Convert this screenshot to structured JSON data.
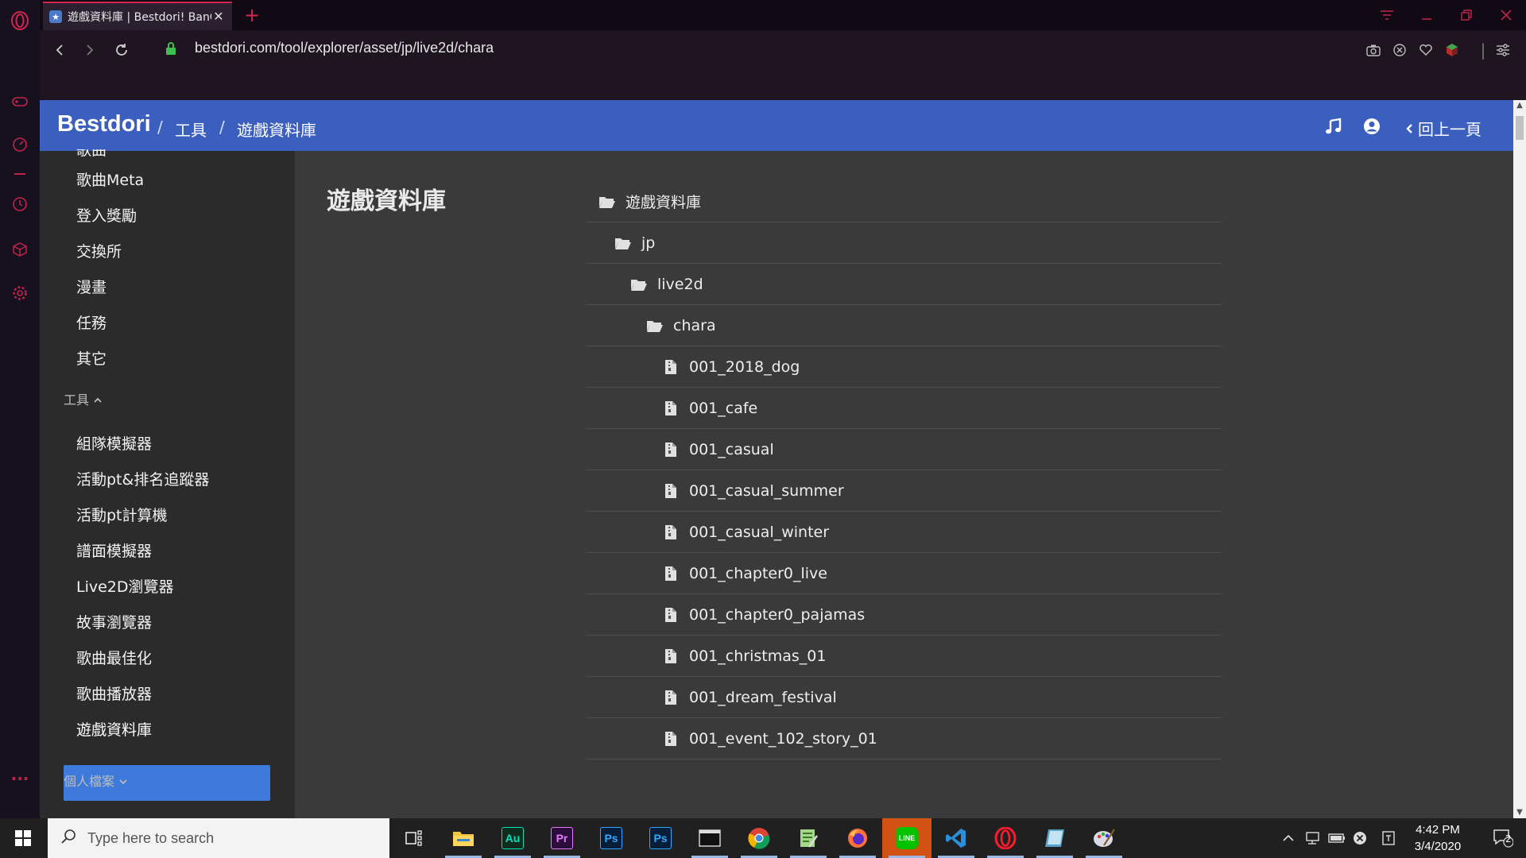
{
  "browser": {
    "tab_title": "遊戲資料庫 | Bestdori! BanG",
    "url": "bestdori.com/tool/explorer/asset/jp/live2d/chara",
    "accent": "#d1254f"
  },
  "navbar": {
    "brand": "Bestdori",
    "breadcrumb_sep": "/",
    "breadcrumb": [
      "工具",
      "遊戲資料庫"
    ],
    "back_label": "回上一頁",
    "color": "#3b5fbe"
  },
  "sidebar": {
    "partial_top_item": "歌曲",
    "items_a": [
      "歌曲Meta",
      "登入獎勵",
      "交換所",
      "漫畫",
      "任務",
      "其它"
    ],
    "tools_heading": "工具",
    "tools_items": [
      "組隊模擬器",
      "活動pt&排名追蹤器",
      "活動pt計算機",
      "譜面模擬器",
      "Live2D瀏覽器",
      "故事瀏覽器",
      "歌曲最佳化",
      "歌曲播放器",
      "遊戲資料庫"
    ],
    "active_item": "遊戲資料庫",
    "profile_heading": "個人檔案"
  },
  "main": {
    "title": "遊戲資料庫",
    "folders": [
      "遊戲資料庫",
      "jp",
      "live2d",
      "chara"
    ],
    "files": [
      "001_2018_dog",
      "001_cafe",
      "001_casual",
      "001_casual_summer",
      "001_casual_winter",
      "001_chapter0_live",
      "001_chapter0_pajamas",
      "001_christmas_01",
      "001_dream_festival",
      "001_event_102_story_01"
    ]
  },
  "taskbar": {
    "search_placeholder": "Type here to search",
    "time": "4:42 PM",
    "date": "3/4/2020",
    "notification_count": "2",
    "apps": [
      {
        "name": "task-view-icon"
      },
      {
        "name": "file-explorer-icon"
      },
      {
        "name": "audition-icon",
        "label": "Au"
      },
      {
        "name": "premiere-icon",
        "label": "Pr"
      },
      {
        "name": "photoshop-icon",
        "label": "Ps"
      },
      {
        "name": "photoshop-icon-2",
        "label": "Ps"
      },
      {
        "name": "terminal-icon"
      },
      {
        "name": "chrome-icon"
      },
      {
        "name": "notepad-icon"
      },
      {
        "name": "firefox-icon"
      },
      {
        "name": "line-icon",
        "label": "LINE"
      },
      {
        "name": "vscode-icon"
      },
      {
        "name": "opera-icon"
      },
      {
        "name": "book-icon"
      },
      {
        "name": "paint-icon"
      }
    ]
  }
}
